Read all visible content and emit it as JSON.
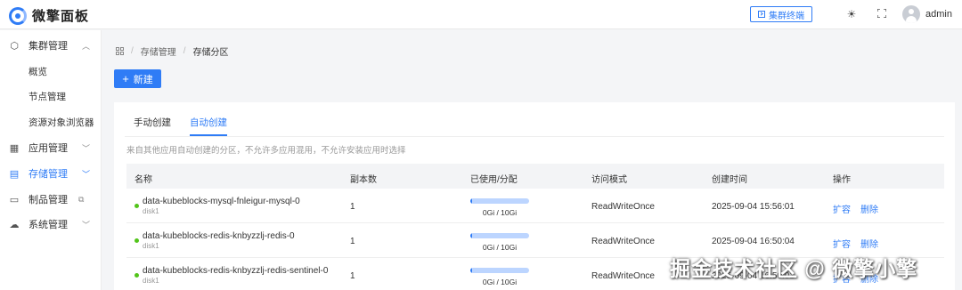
{
  "app": {
    "title": "微擎面板"
  },
  "header": {
    "terminal_label": "集群终端",
    "theme_icon": "sun-icon",
    "fullscreen_icon": "fullscreen-icon",
    "username": "admin"
  },
  "sidebar": {
    "items": [
      {
        "label": "集群管理",
        "icon": "cube-icon",
        "expanded": true
      },
      {
        "label": "概览"
      },
      {
        "label": "节点管理"
      },
      {
        "label": "资源对象浏览器"
      },
      {
        "label": "应用管理",
        "icon": "apps-icon"
      },
      {
        "label": "存储管理",
        "icon": "storage-icon",
        "active": true
      },
      {
        "label": "制品管理",
        "icon": "package-icon",
        "external_icon": "external-link-icon"
      },
      {
        "label": "系统管理",
        "icon": "cloud-icon"
      }
    ]
  },
  "breadcrumb": {
    "items": [
      "存储管理",
      "存储分区"
    ]
  },
  "toolbar": {
    "new_label": "新建"
  },
  "tabs": [
    {
      "label": "手动创建"
    },
    {
      "label": "自动创建",
      "active": true
    }
  ],
  "hint": "来自其他应用自动创建的分区，不允许多应用混用，不允许安装应用时选择",
  "table": {
    "columns": [
      "名称",
      "副本数",
      "已使用/分配",
      "访问模式",
      "创建时间",
      "操作"
    ],
    "rows": [
      {
        "name": "data-kubeblocks-mysql-fnleigur-mysql-0",
        "disk": "disk1",
        "replicas": "1",
        "usage": "0Gi / 10Gi",
        "usage_fraction": 0.02,
        "access_mode": "ReadWriteOnce",
        "created": "2025-09-04 15:56:01",
        "actions": [
          "扩容",
          "删除"
        ]
      },
      {
        "name": "data-kubeblocks-redis-knbyzzlj-redis-0",
        "disk": "disk1",
        "replicas": "1",
        "usage": "0Gi / 10Gi",
        "usage_fraction": 0.02,
        "access_mode": "ReadWriteOnce",
        "created": "2025-09-04 16:50:04",
        "actions": [
          "扩容",
          "删除"
        ]
      },
      {
        "name": "data-kubeblocks-redis-knbyzzlj-redis-sentinel-0",
        "disk": "disk1",
        "replicas": "1",
        "usage": "0Gi / 10Gi",
        "usage_fraction": 0.02,
        "access_mode": "ReadWriteOnce",
        "created": "2025-09-04 16:50:01",
        "actions": [
          "扩容",
          "删除"
        ]
      }
    ]
  },
  "watermark": "掘金技术社区 @ 微擎小擎",
  "colors": {
    "accent": "#2f7cf6",
    "status_dot": "#52c41a"
  }
}
